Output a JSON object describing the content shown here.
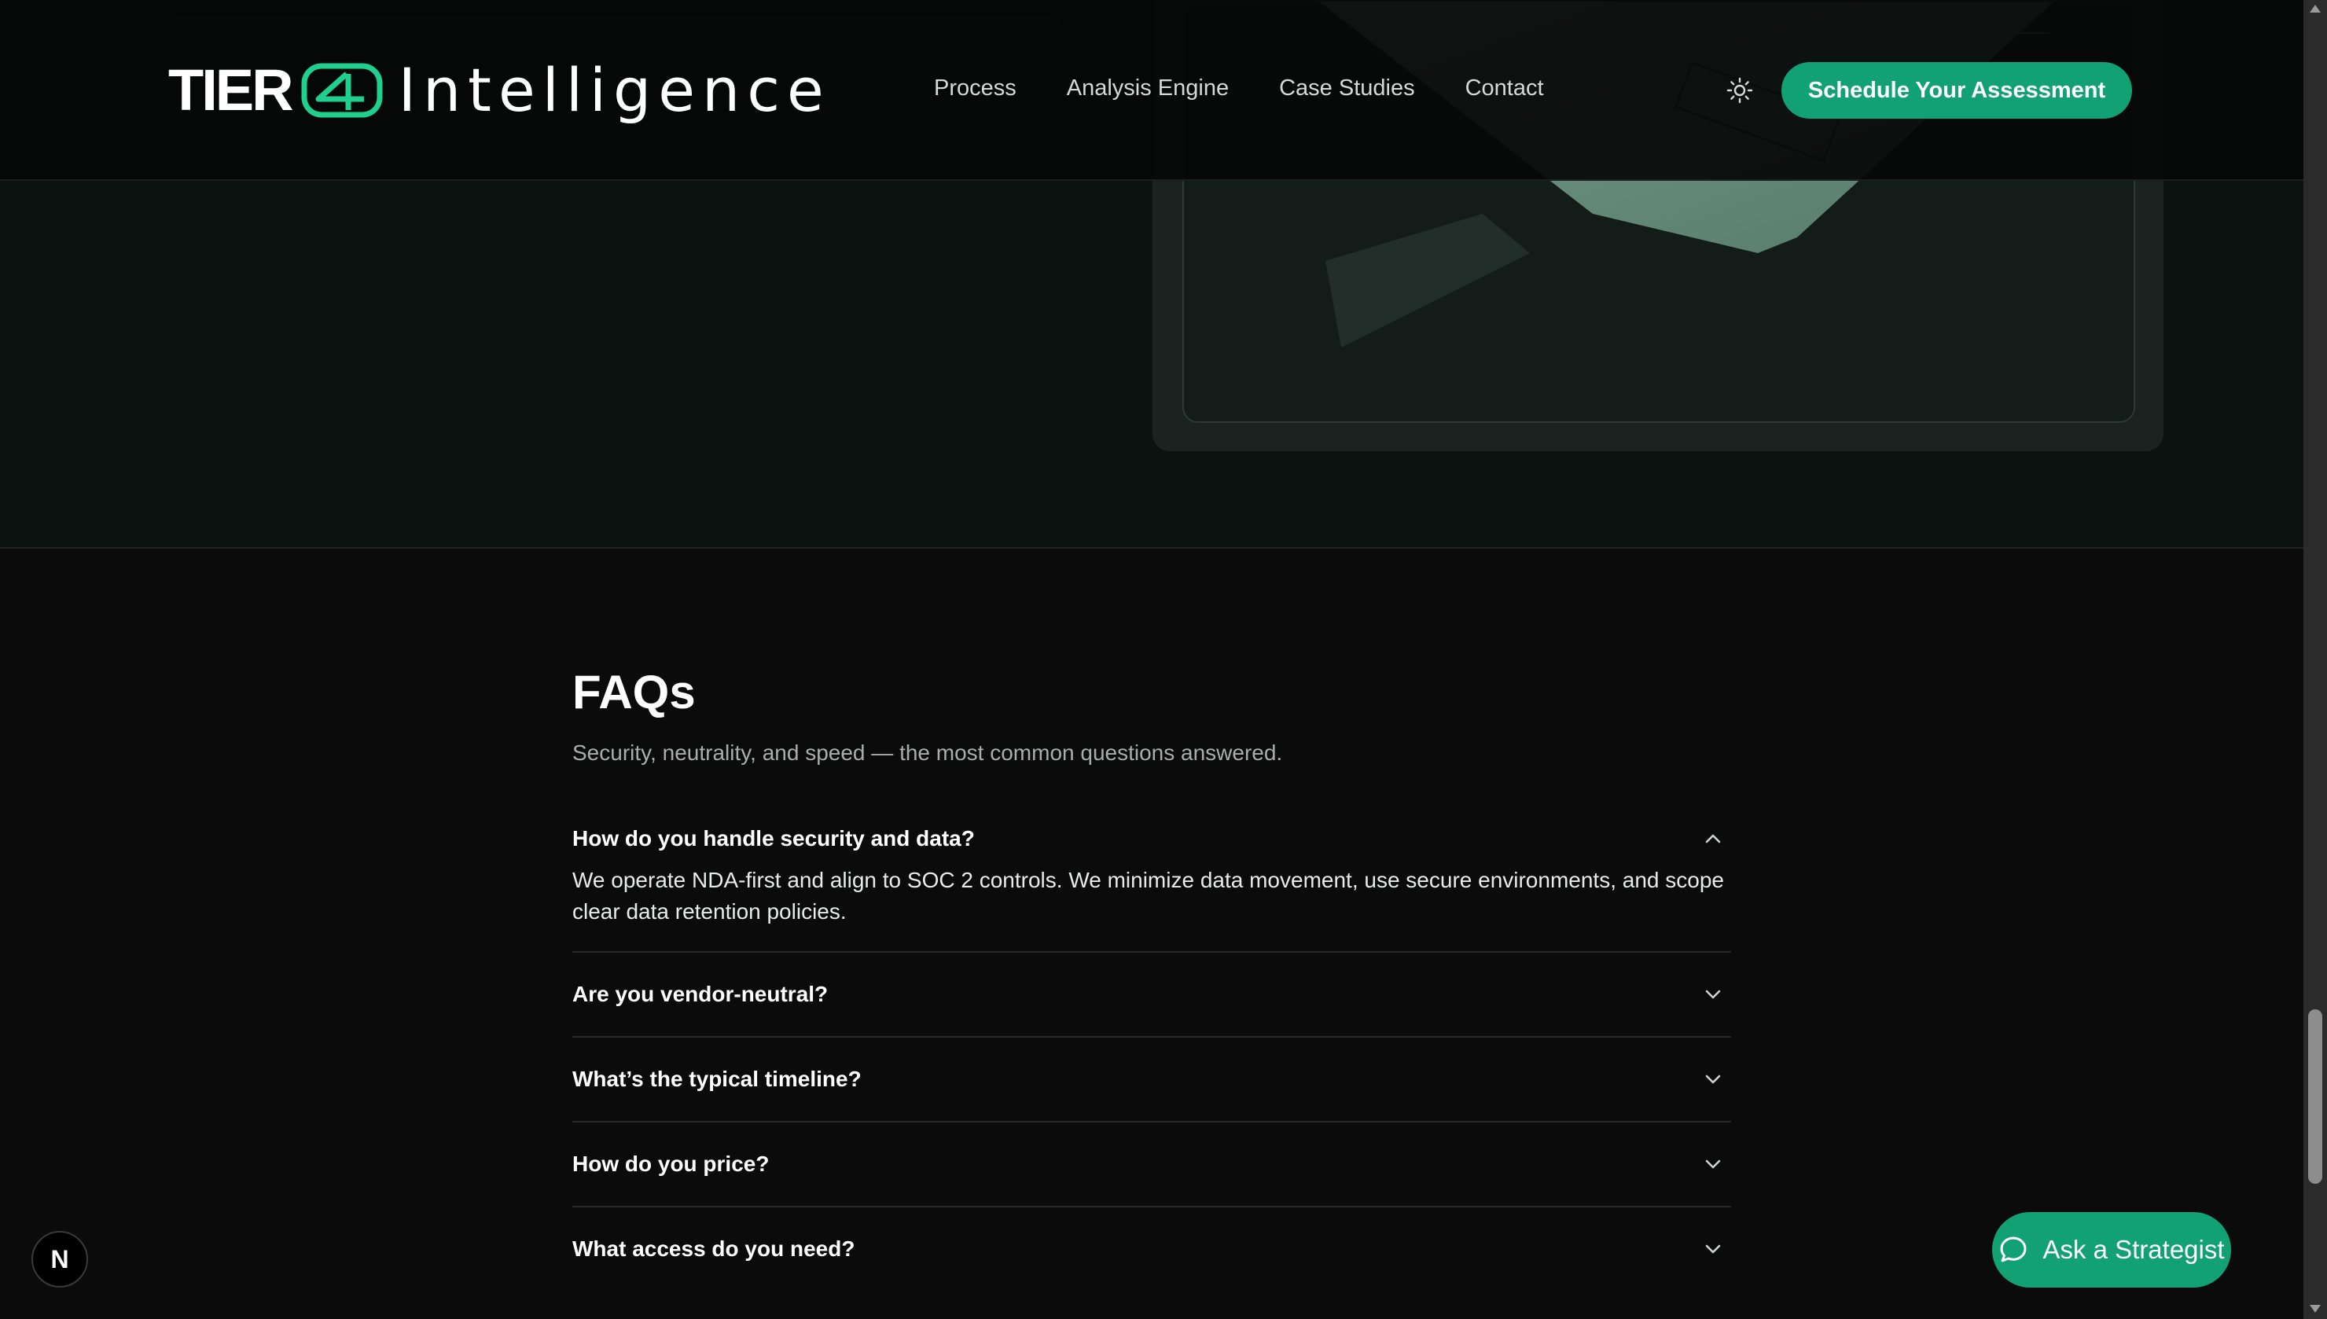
{
  "header": {
    "logo_tier": "TIER",
    "logo_word": "Intelligence",
    "nav": [
      "Process",
      "Analysis Engine",
      "Case Studies",
      "Contact"
    ],
    "cta": "Schedule Your Assessment"
  },
  "faq": {
    "title": "FAQs",
    "subtitle": "Security, neutrality, and speed — the most common questions answered.",
    "items": [
      {
        "question": "How do you handle security and data?",
        "answer": "We operate NDA-first and align to SOC 2 controls. We minimize data movement, use secure environments, and scope clear data retention policies.",
        "open": true
      },
      {
        "question": "Are you vendor-neutral?",
        "open": false
      },
      {
        "question": "What’s the typical timeline?",
        "open": false
      },
      {
        "question": "How do you price?",
        "open": false
      },
      {
        "question": "What access do you need?",
        "open": false
      }
    ]
  },
  "floating": {
    "ask_label": "Ask a Strategist",
    "next_badge": "N"
  },
  "colors": {
    "accent": "#12a173",
    "background": "#0b0b0b",
    "header_bg": "#060808"
  }
}
